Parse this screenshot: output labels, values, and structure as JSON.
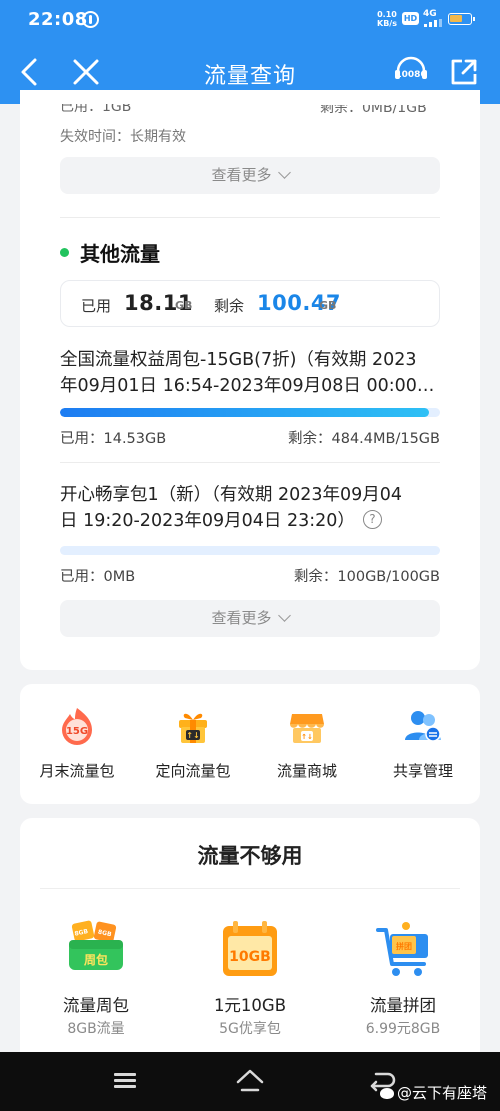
{
  "status_bar": {
    "time": "22:08",
    "speed_value": "0.10",
    "speed_unit": "KB/s",
    "hd_badge": "HD",
    "network": "4G"
  },
  "header": {
    "title": "流量查询",
    "hotline": "10086"
  },
  "first_section": {
    "used_partial": "已用：1GB",
    "remaining_partial": "剩余：0MB/1GB",
    "expire": "失效时间：长期有效",
    "more_label": "查看更多"
  },
  "other_traffic": {
    "title": "其他流量",
    "used_label": "已用",
    "used_value": "18.11",
    "used_unit": "GB",
    "remaining_label": "剩余",
    "remaining_value": "100.47",
    "remaining_unit": "GB",
    "packages": [
      {
        "name_line1": "全国流量权益周包-15GB(7折)（有效期 2023",
        "name_line2": "年09月01日 16:54-2023年09月08日 00:00…",
        "used": "已用：14.53GB",
        "remaining": "剩余：484.4MB/15GB",
        "progress": 0.97
      },
      {
        "name_line1": "开心畅享包1（新）（有效期 2023年09月04",
        "name_line2": "日 19:20-2023年09月04日 23:20）",
        "used": "已用：0MB",
        "remaining": "剩余：100GB/100GB",
        "progress": 0.0
      }
    ],
    "more_label": "查看更多"
  },
  "quick_entries": [
    {
      "label": "月末流量包",
      "icon": "15G",
      "icon_name": "month-end-package-icon"
    },
    {
      "label": "定向流量包",
      "icon": "gift",
      "icon_name": "directional-package-icon"
    },
    {
      "label": "流量商城",
      "icon": "shop",
      "icon_name": "traffic-mall-icon"
    },
    {
      "label": "共享管理",
      "icon": "share-users",
      "icon_name": "share-management-icon"
    }
  ],
  "not_enough": {
    "title": "流量不够用",
    "offers": [
      {
        "name": "流量周包",
        "sub": "8GB流量",
        "badge": "周包",
        "tag1": "8GB",
        "tag2": "8GB"
      },
      {
        "name": "1元10GB",
        "sub": "5G优享包",
        "badge": "10GB"
      },
      {
        "name": "流量拼团",
        "sub": "6.99元8GB",
        "badge": "拼团"
      }
    ]
  },
  "watermark": "@云下有座塔",
  "colors": {
    "header_blue": "#2d91f2",
    "progress_start": "#1d7cf2",
    "progress_end": "#2ec0f5",
    "green_dot": "#22c35e"
  }
}
